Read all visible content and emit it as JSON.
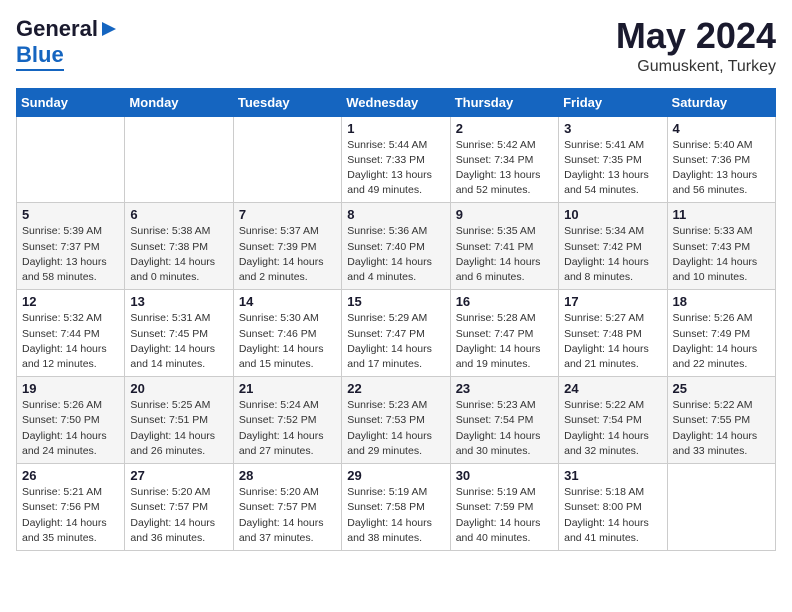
{
  "header": {
    "logo_general": "General",
    "logo_blue": "Blue",
    "month": "May 2024",
    "location": "Gumuskent, Turkey"
  },
  "weekdays": [
    "Sunday",
    "Monday",
    "Tuesday",
    "Wednesday",
    "Thursday",
    "Friday",
    "Saturday"
  ],
  "weeks": [
    [
      {
        "day": "",
        "info": ""
      },
      {
        "day": "",
        "info": ""
      },
      {
        "day": "",
        "info": ""
      },
      {
        "day": "1",
        "info": "Sunrise: 5:44 AM\nSunset: 7:33 PM\nDaylight: 13 hours\nand 49 minutes."
      },
      {
        "day": "2",
        "info": "Sunrise: 5:42 AM\nSunset: 7:34 PM\nDaylight: 13 hours\nand 52 minutes."
      },
      {
        "day": "3",
        "info": "Sunrise: 5:41 AM\nSunset: 7:35 PM\nDaylight: 13 hours\nand 54 minutes."
      },
      {
        "day": "4",
        "info": "Sunrise: 5:40 AM\nSunset: 7:36 PM\nDaylight: 13 hours\nand 56 minutes."
      }
    ],
    [
      {
        "day": "5",
        "info": "Sunrise: 5:39 AM\nSunset: 7:37 PM\nDaylight: 13 hours\nand 58 minutes."
      },
      {
        "day": "6",
        "info": "Sunrise: 5:38 AM\nSunset: 7:38 PM\nDaylight: 14 hours\nand 0 minutes."
      },
      {
        "day": "7",
        "info": "Sunrise: 5:37 AM\nSunset: 7:39 PM\nDaylight: 14 hours\nand 2 minutes."
      },
      {
        "day": "8",
        "info": "Sunrise: 5:36 AM\nSunset: 7:40 PM\nDaylight: 14 hours\nand 4 minutes."
      },
      {
        "day": "9",
        "info": "Sunrise: 5:35 AM\nSunset: 7:41 PM\nDaylight: 14 hours\nand 6 minutes."
      },
      {
        "day": "10",
        "info": "Sunrise: 5:34 AM\nSunset: 7:42 PM\nDaylight: 14 hours\nand 8 minutes."
      },
      {
        "day": "11",
        "info": "Sunrise: 5:33 AM\nSunset: 7:43 PM\nDaylight: 14 hours\nand 10 minutes."
      }
    ],
    [
      {
        "day": "12",
        "info": "Sunrise: 5:32 AM\nSunset: 7:44 PM\nDaylight: 14 hours\nand 12 minutes."
      },
      {
        "day": "13",
        "info": "Sunrise: 5:31 AM\nSunset: 7:45 PM\nDaylight: 14 hours\nand 14 minutes."
      },
      {
        "day": "14",
        "info": "Sunrise: 5:30 AM\nSunset: 7:46 PM\nDaylight: 14 hours\nand 15 minutes."
      },
      {
        "day": "15",
        "info": "Sunrise: 5:29 AM\nSunset: 7:47 PM\nDaylight: 14 hours\nand 17 minutes."
      },
      {
        "day": "16",
        "info": "Sunrise: 5:28 AM\nSunset: 7:47 PM\nDaylight: 14 hours\nand 19 minutes."
      },
      {
        "day": "17",
        "info": "Sunrise: 5:27 AM\nSunset: 7:48 PM\nDaylight: 14 hours\nand 21 minutes."
      },
      {
        "day": "18",
        "info": "Sunrise: 5:26 AM\nSunset: 7:49 PM\nDaylight: 14 hours\nand 22 minutes."
      }
    ],
    [
      {
        "day": "19",
        "info": "Sunrise: 5:26 AM\nSunset: 7:50 PM\nDaylight: 14 hours\nand 24 minutes."
      },
      {
        "day": "20",
        "info": "Sunrise: 5:25 AM\nSunset: 7:51 PM\nDaylight: 14 hours\nand 26 minutes."
      },
      {
        "day": "21",
        "info": "Sunrise: 5:24 AM\nSunset: 7:52 PM\nDaylight: 14 hours\nand 27 minutes."
      },
      {
        "day": "22",
        "info": "Sunrise: 5:23 AM\nSunset: 7:53 PM\nDaylight: 14 hours\nand 29 minutes."
      },
      {
        "day": "23",
        "info": "Sunrise: 5:23 AM\nSunset: 7:54 PM\nDaylight: 14 hours\nand 30 minutes."
      },
      {
        "day": "24",
        "info": "Sunrise: 5:22 AM\nSunset: 7:54 PM\nDaylight: 14 hours\nand 32 minutes."
      },
      {
        "day": "25",
        "info": "Sunrise: 5:22 AM\nSunset: 7:55 PM\nDaylight: 14 hours\nand 33 minutes."
      }
    ],
    [
      {
        "day": "26",
        "info": "Sunrise: 5:21 AM\nSunset: 7:56 PM\nDaylight: 14 hours\nand 35 minutes."
      },
      {
        "day": "27",
        "info": "Sunrise: 5:20 AM\nSunset: 7:57 PM\nDaylight: 14 hours\nand 36 minutes."
      },
      {
        "day": "28",
        "info": "Sunrise: 5:20 AM\nSunset: 7:57 PM\nDaylight: 14 hours\nand 37 minutes."
      },
      {
        "day": "29",
        "info": "Sunrise: 5:19 AM\nSunset: 7:58 PM\nDaylight: 14 hours\nand 38 minutes."
      },
      {
        "day": "30",
        "info": "Sunrise: 5:19 AM\nSunset: 7:59 PM\nDaylight: 14 hours\nand 40 minutes."
      },
      {
        "day": "31",
        "info": "Sunrise: 5:18 AM\nSunset: 8:00 PM\nDaylight: 14 hours\nand 41 minutes."
      },
      {
        "day": "",
        "info": ""
      }
    ]
  ]
}
